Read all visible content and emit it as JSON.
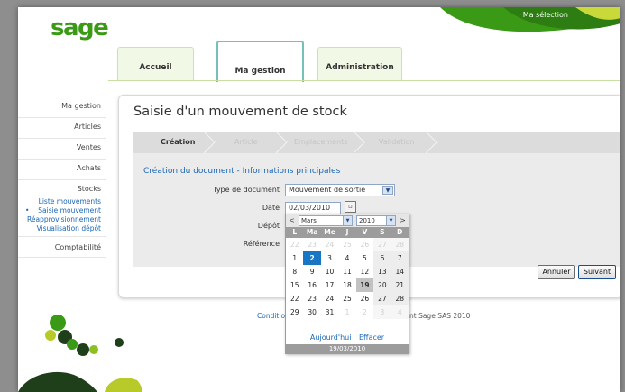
{
  "header": {
    "logo_text": "sage",
    "my_selection": "Ma sélection"
  },
  "tabs": [
    {
      "label": "Accueil",
      "active": false
    },
    {
      "label": "Ma gestion",
      "active": true
    },
    {
      "label": "Administration",
      "active": false
    }
  ],
  "sidebar": {
    "items": [
      {
        "label": "Ma gestion"
      },
      {
        "label": "Articles"
      },
      {
        "label": "Ventes"
      },
      {
        "label": "Achats"
      },
      {
        "label": "Stocks"
      }
    ],
    "subitems": [
      {
        "label": "Liste mouvements",
        "active": false
      },
      {
        "label": "Saisie mouvement",
        "active": true
      },
      {
        "label": "Réapprovisionnement",
        "active": false
      },
      {
        "label": "Visualisation dépôt",
        "active": false
      }
    ],
    "last_item": "Comptabilité"
  },
  "page": {
    "title": "Saisie d'un mouvement de stock",
    "steps": [
      {
        "label": "Création",
        "current": true
      },
      {
        "label": "Article",
        "current": false
      },
      {
        "label": "Emplacements",
        "current": false
      },
      {
        "label": "Validation",
        "current": false
      }
    ],
    "section_title": "Création du document - Informations principales"
  },
  "form": {
    "type_label": "Type de document",
    "type_value": "Mouvement de sortie",
    "date_label": "Date",
    "date_value": "02/03/2010",
    "depot_label": "Dépôt",
    "reference_label": "Référence"
  },
  "buttons": {
    "cancel": "Annuler",
    "next": "Suivant"
  },
  "footer": {
    "link": "Conditio",
    "copyright": "nt Sage SAS 2010"
  },
  "calendar": {
    "prev": "<",
    "next": ">",
    "month": "Mars",
    "year": "2010",
    "weekdays": [
      "L",
      "Ma",
      "Me",
      "J",
      "V",
      "S",
      "D"
    ],
    "weeks": [
      [
        "22",
        "23",
        "24",
        "25",
        "26",
        "27",
        "28"
      ],
      [
        "1",
        "2",
        "3",
        "4",
        "5",
        "6",
        "7"
      ],
      [
        "8",
        "9",
        "10",
        "11",
        "12",
        "13",
        "14"
      ],
      [
        "15",
        "16",
        "17",
        "18",
        "19",
        "20",
        "21"
      ],
      [
        "22",
        "23",
        "24",
        "25",
        "26",
        "27",
        "28"
      ],
      [
        "29",
        "30",
        "31",
        "1",
        "2",
        "3",
        "4"
      ]
    ],
    "selected_day": "2",
    "today_day": "19",
    "today_label": "Aujourd'hui",
    "clear_label": "Effacer",
    "footer_date": "19/03/2010"
  },
  "colors": {
    "brand_green": "#3a9a16",
    "link_blue": "#1a66b4",
    "selected_blue": "#1976c4",
    "tab_border_active": "#77c0b7"
  }
}
